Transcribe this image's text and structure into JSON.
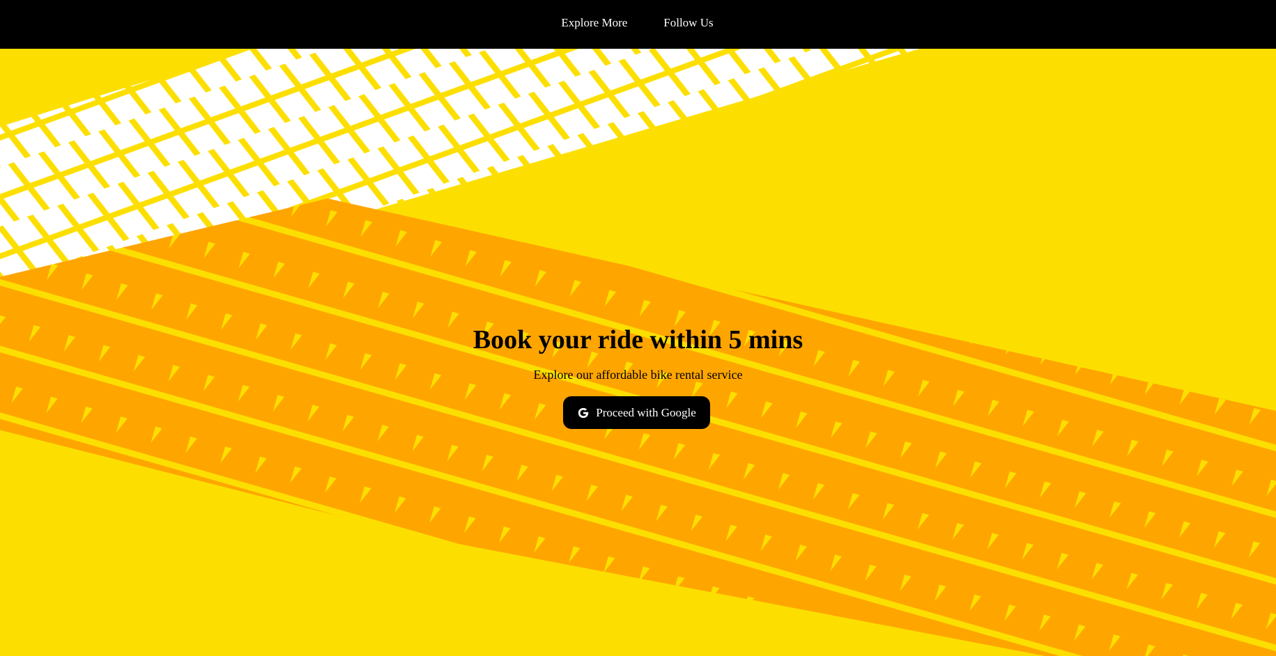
{
  "nav": {
    "items": [
      {
        "label": "Explore More"
      },
      {
        "label": "Follow Us"
      }
    ]
  },
  "hero": {
    "title": "Book your ride within 5 mins",
    "subtitle": "Explore our affordable bike rental service",
    "cta": {
      "label": "Proceed with Google",
      "icon": "google-g-icon"
    }
  },
  "colors": {
    "background": "#fcdf00",
    "tire_track_orange": "#ffa500",
    "tire_track_white": "#ffffff",
    "topbar": "#000000",
    "button": "#000000",
    "button_text": "#ffffff"
  }
}
